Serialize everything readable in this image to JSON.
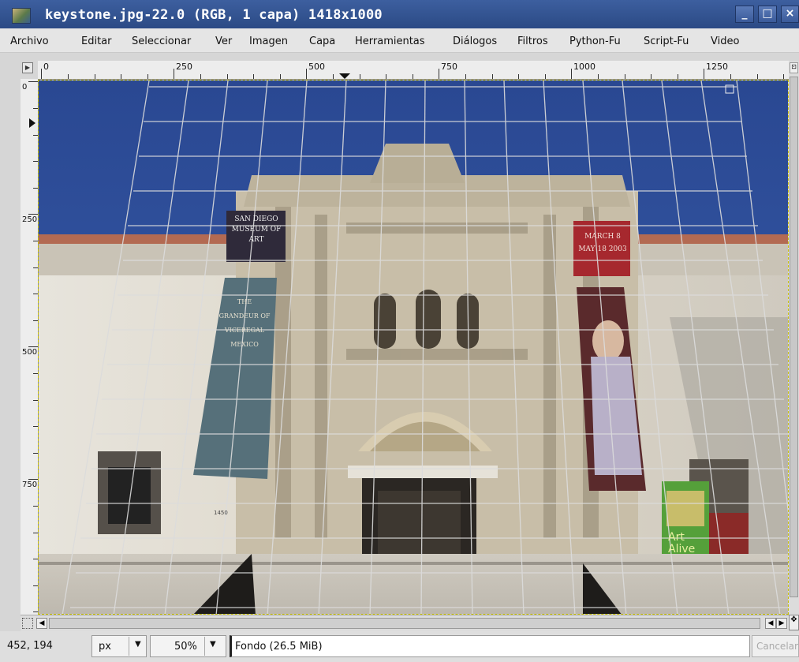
{
  "window": {
    "title": "keystone.jpg-22.0 (RGB, 1 capa) 1418x1000"
  },
  "menu": {
    "items": [
      {
        "label": "Archivo"
      },
      {
        "label": "Editar"
      },
      {
        "label": "Seleccionar"
      },
      {
        "label": "Ver"
      },
      {
        "label": "Imagen"
      },
      {
        "label": "Capa"
      },
      {
        "label": "Herramientas"
      },
      {
        "label": "Diálogos"
      },
      {
        "label": "Filtros"
      },
      {
        "label": "Python-Fu"
      },
      {
        "label": "Script-Fu"
      },
      {
        "label": "Video"
      }
    ]
  },
  "rulers": {
    "horizontal": [
      "0",
      "250",
      "500",
      "750",
      "1000",
      "1250"
    ],
    "vertical": [
      "0",
      "250",
      "500",
      "750"
    ]
  },
  "canvas": {
    "banner_left_top": "SAN DIEGO MUSEUM OF ART",
    "banner_left": "THE GRANDEUR OF VICEREGAL MEXICO",
    "banner_right_top": "MARCH 8 MAY 18 2003",
    "sign_text": "Art Alive",
    "plaque": "1450"
  },
  "status": {
    "coords": "452, 194",
    "unit": "px",
    "zoom": "50%",
    "message": "Fondo (26.5 MiB)",
    "cancel": "Cancelar"
  },
  "colors": {
    "sky": "#2e4f9a",
    "titlebar": "#2b4a85",
    "grid": "#d8d8d8"
  }
}
